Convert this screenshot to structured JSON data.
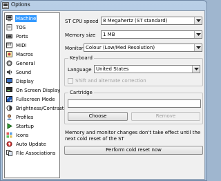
{
  "window": {
    "title": "Options"
  },
  "sidebar": {
    "items": [
      {
        "label": "Machine",
        "icon": "machine-icon",
        "selected": true
      },
      {
        "label": "TOS",
        "icon": "tos-icon"
      },
      {
        "label": "Ports",
        "icon": "ports-icon"
      },
      {
        "label": "MIDI",
        "icon": "midi-icon"
      },
      {
        "label": "Macros",
        "icon": "macros-icon"
      },
      {
        "label": "General",
        "icon": "general-icon"
      },
      {
        "label": "Sound",
        "icon": "sound-icon"
      },
      {
        "label": "Display",
        "icon": "display-icon"
      },
      {
        "label": "On Screen Display",
        "icon": "osd-icon"
      },
      {
        "label": "Fullscreen Mode",
        "icon": "fullscreen-icon"
      },
      {
        "label": "Brightness/Contrast",
        "icon": "brightness-icon"
      },
      {
        "label": "Profiles",
        "icon": "profiles-icon"
      },
      {
        "label": "Startup",
        "icon": "startup-icon"
      },
      {
        "label": "Icons",
        "icon": "icons-icon"
      },
      {
        "label": "Auto Update",
        "icon": "auto-update-icon"
      },
      {
        "label": "File Associations",
        "icon": "file-associations-icon"
      }
    ]
  },
  "machine": {
    "cpu_speed_label": "ST CPU speed",
    "cpu_speed_value": "8 Megahertz (ST standard)",
    "memory_label": "Memory size",
    "memory_value": "1 MB",
    "monitor_label": "Monitor",
    "monitor_value": "Colour (Low/Med Resolution)",
    "keyboard": {
      "title": "Keyboard",
      "language_label": "Language",
      "language_value": "United States",
      "shift_label": "Shift and alternate correction"
    },
    "cartridge": {
      "title": "Cartridge",
      "path_value": "",
      "choose_label": "Choose",
      "remove_label": "Remove"
    },
    "note": "Memory and monitor changes don't take effect until the next cold reset of the ST",
    "cold_reset_label": "Perform cold reset now"
  },
  "colors": {
    "selection": "#3399ff",
    "title_bar": "#b9cfe6",
    "dialog_bg": "#f0f0f0"
  }
}
